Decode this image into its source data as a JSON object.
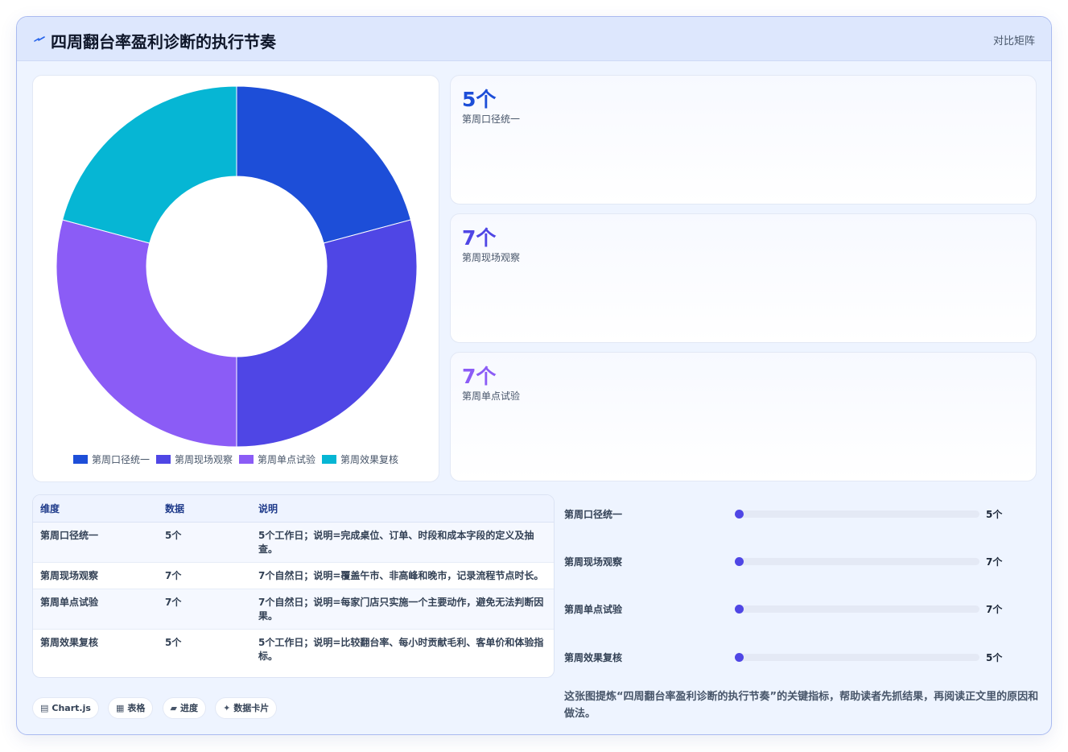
{
  "header": {
    "title": "四周翻台率盈利诊断的执行节奏",
    "tag": "对比矩阵",
    "title_icon": "lightning-icon"
  },
  "colors": {
    "blue": "#1d4ed8",
    "indigo": "#4f46e5",
    "violet": "#8b5cf6",
    "cyan": "#06b6d4"
  },
  "chart_data": {
    "type": "pie",
    "variant": "doughnut",
    "categories": [
      "第周口径统一",
      "第周现场观察",
      "第周单点试验",
      "第周效果复核"
    ],
    "values": [
      5,
      7,
      7,
      5
    ],
    "unit": "个",
    "colors": [
      "#1d4ed8",
      "#4f46e5",
      "#8b5cf6",
      "#06b6d4"
    ],
    "legend": "bottom"
  },
  "stats": [
    {
      "value": "5个",
      "label": "第周口径统一",
      "color": "#1d4ed8"
    },
    {
      "value": "7个",
      "label": "第周现场观察",
      "color": "#4f46e5"
    },
    {
      "value": "7个",
      "label": "第周单点试验",
      "color": "#8b5cf6"
    }
  ],
  "table": {
    "headers": [
      "维度",
      "数据",
      "说明"
    ],
    "rows": [
      [
        "第周口径统一",
        "5个",
        "5个工作日；说明=完成桌位、订单、时段和成本字段的定义及抽查。"
      ],
      [
        "第周现场观察",
        "7个",
        "7个自然日；说明=覆盖午市、非高峰和晚市，记录流程节点时长。"
      ],
      [
        "第周单点试验",
        "7个",
        "7个自然日；说明=每家门店只实施一个主要动作，避免无法判断因果。"
      ],
      [
        "第周效果复核",
        "5个",
        "5个工作日；说明=比较翻台率、每小时贡献毛利、客单价和体验指标。"
      ]
    ]
  },
  "progress": [
    {
      "label": "第周口径统一",
      "value": "5个",
      "fraction": 0.0
    },
    {
      "label": "第周现场观察",
      "value": "7个",
      "fraction": 0.0
    },
    {
      "label": "第周单点试验",
      "value": "7个",
      "fraction": 0.0
    },
    {
      "label": "第周效果复核",
      "value": "5个",
      "fraction": 0.0
    }
  ],
  "badges": [
    {
      "icon": "chart-icon",
      "glyph": "▤",
      "label": "Chart.js"
    },
    {
      "icon": "table-icon",
      "glyph": "▦",
      "label": "表格"
    },
    {
      "icon": "progress-icon",
      "glyph": "▰",
      "label": "进度"
    },
    {
      "icon": "sparkle-icon",
      "glyph": "✦",
      "label": "数据卡片"
    }
  ],
  "footnote": "这张图提炼“四周翻台率盈利诊断的执行节奏”的关键指标，帮助读者先抓结果，再阅读正文里的原因和做法。"
}
